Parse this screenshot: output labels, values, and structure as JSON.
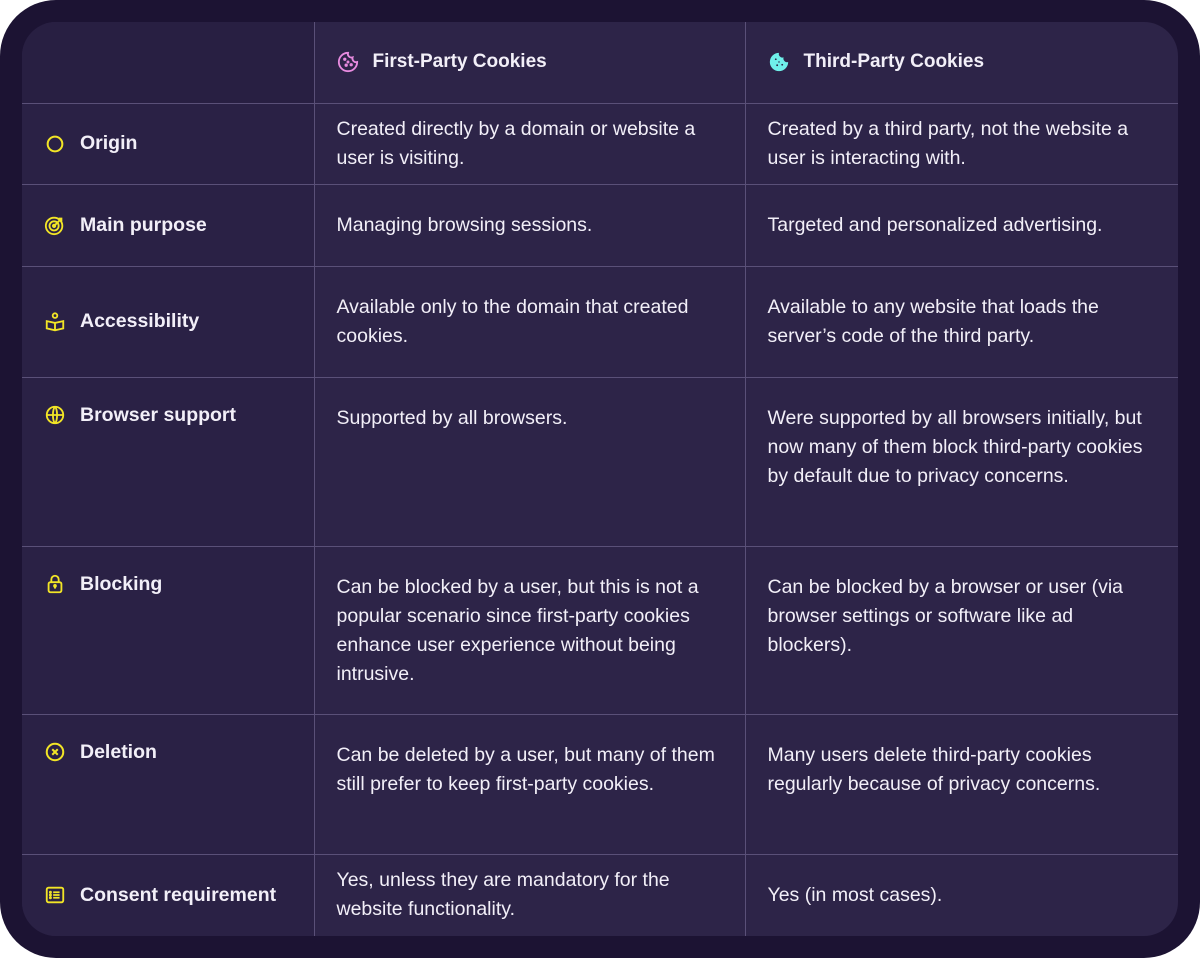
{
  "columns": {
    "first_party": {
      "label": "First-Party Cookies",
      "icon": "cookie-icon",
      "icon_color": "#e88be0"
    },
    "third_party": {
      "label": "Third-Party Cookies",
      "icon": "cookie-icon",
      "icon_color": "#6ff0ea"
    }
  },
  "accent_color": "#f2e526",
  "rows": [
    {
      "label": "Origin",
      "icon": "circle-icon",
      "first": "Created directly by a domain or website a user is visiting.",
      "third": "Created by a third party, not the website a user is interacting with."
    },
    {
      "label": "Main purpose",
      "icon": "target-icon",
      "first": "Managing browsing sessions.",
      "third": "Targeted and personalized advertising."
    },
    {
      "label": "Accessibility",
      "icon": "reader-icon",
      "first": "Available only to the domain that created cookies.",
      "third": "Available to any website that loads the server’s code of the third party."
    },
    {
      "label": "Browser support",
      "icon": "globe-icon",
      "first": "Supported by all browsers.",
      "third": "Were supported by all browsers initially, but now many of them block third-party cookies by default due to privacy concerns."
    },
    {
      "label": "Blocking",
      "icon": "lock-icon",
      "first": "Can be blocked by a user, but this is not a popular scenario since first-party cookies enhance user experience without being intrusive.",
      "third": "Can be blocked by a browser or user (via browser settings or software like ad blockers)."
    },
    {
      "label": "Deletion",
      "icon": "close-circle-icon",
      "first": "Can be deleted by a user, but many of them still prefer to keep first-party cookies.",
      "third": "Many users delete third-party cookies regularly because of privacy concerns."
    },
    {
      "label": "Consent requirement",
      "icon": "list-icon",
      "first": "Yes, unless they are mandatory for the website functionality.",
      "third": "Yes (in most cases)."
    }
  ]
}
